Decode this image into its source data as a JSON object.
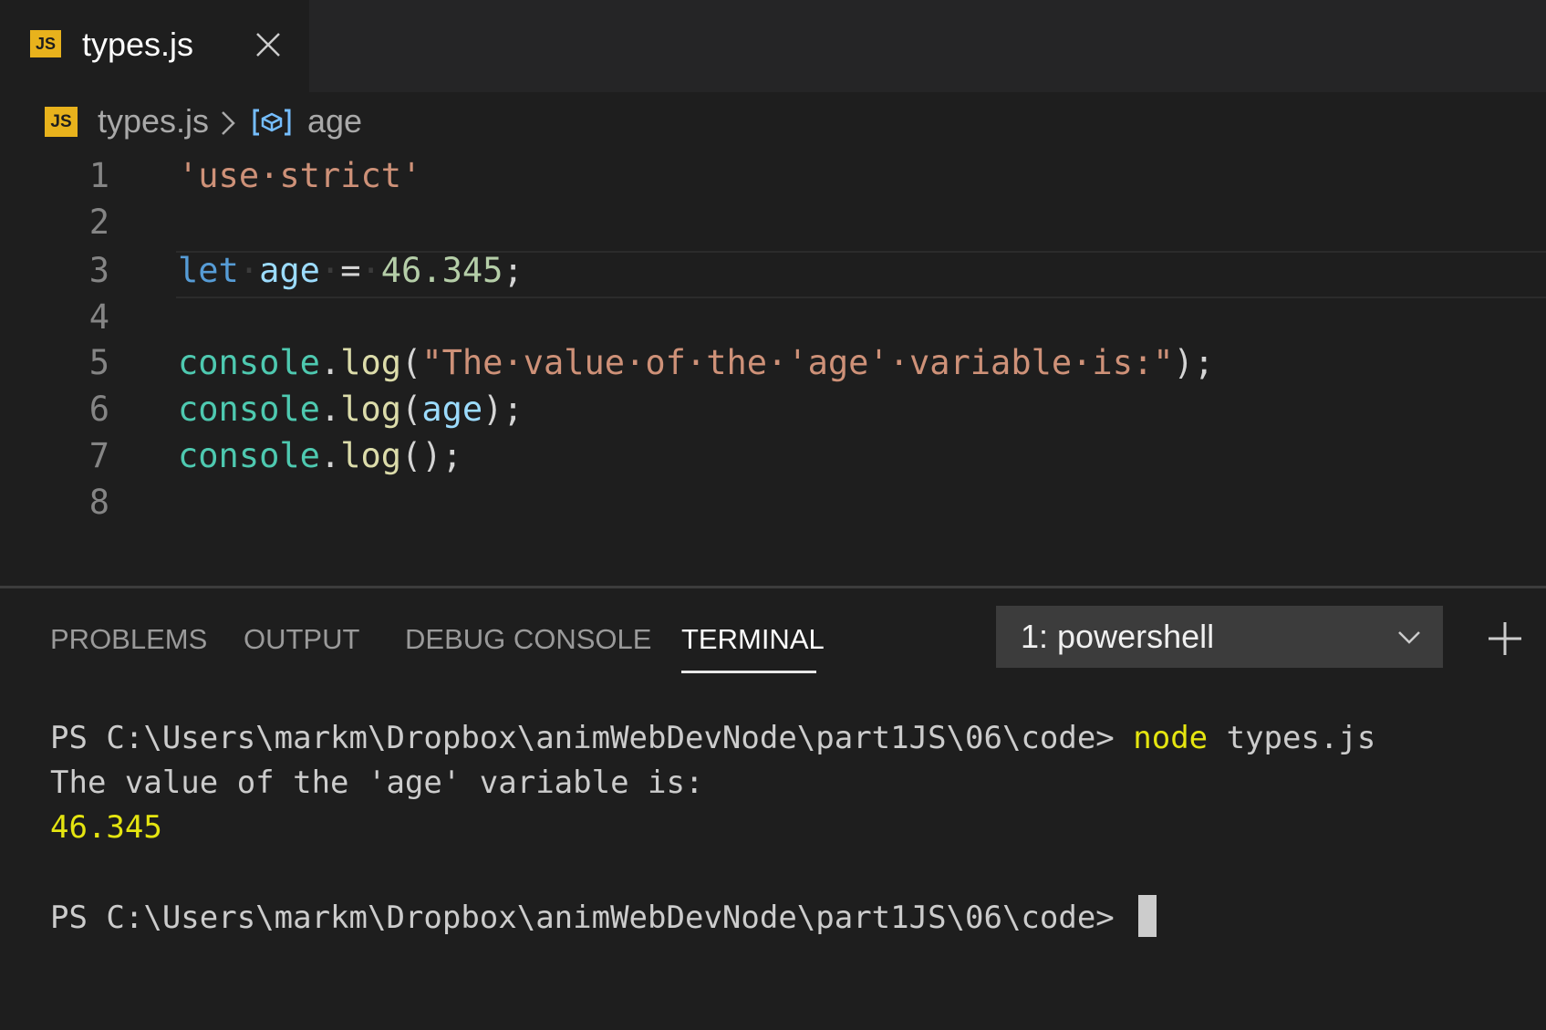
{
  "tab": {
    "icon": "JS",
    "label": "types.js"
  },
  "breadcrumb": {
    "icon": "JS",
    "file": "types.js",
    "symbol": "age"
  },
  "editor": {
    "line_numbers": [
      "1",
      "2",
      "3",
      "4",
      "5",
      "6",
      "7",
      "8"
    ],
    "lines": {
      "l1": {
        "str": "'use·strict'"
      },
      "l3": {
        "kw": "let",
        "var": "age",
        "eq": "=",
        "num": "46.345",
        "semi": ";"
      },
      "l5": {
        "obj": "console",
        "dot": ".",
        "fn": "log",
        "open": "(",
        "str": "\"The·value·of·the·'age'·variable·is:\"",
        "close": ");"
      },
      "l6": {
        "obj": "console",
        "dot": ".",
        "fn": "log",
        "open": "(",
        "var": "age",
        "close": ");"
      },
      "l7": {
        "obj": "console",
        "dot": ".",
        "fn": "log",
        "rest": "();"
      }
    }
  },
  "panel": {
    "tabs": [
      "PROBLEMS",
      "OUTPUT",
      "DEBUG CONSOLE",
      "TERMINAL"
    ],
    "active_tab": "TERMINAL",
    "terminal_selector": "1: powershell"
  },
  "terminal": {
    "prompt1": "PS C:\\Users\\markm\\Dropbox\\animWebDevNode\\part1JS\\06\\code> ",
    "cmd_node": "node",
    "cmd_rest": " types.js",
    "output1": "The value of the 'age' variable is:",
    "output2": "46.345",
    "prompt2": "PS C:\\Users\\markm\\Dropbox\\animWebDevNode\\part1JS\\06\\code> "
  }
}
